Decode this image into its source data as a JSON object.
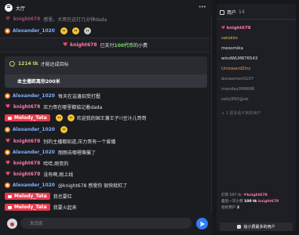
{
  "header": {
    "title": "大厅"
  },
  "messages_top": [
    {
      "badge": "heart",
      "user": "knight678",
      "user_color": "pink",
      "text": "感恩，大哥在这打几分钟dada",
      "emoji": false
    },
    {
      "badge": "orange",
      "user": "Alexander_1020",
      "user_color": "blue",
      "text": "",
      "emoji": true
    }
  ],
  "gift": {
    "user": "knight678",
    "pre": "已支付",
    "amount": "100代币",
    "post": "的小费"
  },
  "goal": {
    "tk": "1214 tk",
    "goal_text": "才能达成目标",
    "bar_text": "本主播距离你200米"
  },
  "messages": [
    {
      "badge": "orange",
      "user": "Alexander_1020",
      "user_color": "blue",
      "text": "每天在這邊招受打壓"
    },
    {
      "badge": "heart",
      "user": "knight678",
      "user_color": "pink",
      "text": "压力哥在哪里都惦记着dada"
    },
    {
      "badge": "pill",
      "user": "Melody_Tata",
      "user_color": "",
      "text": "欢迎我的国王兼王子!!豆汁儿哥哥"
    },
    {
      "badge": "orange",
      "user": "Alexander_1020",
      "user_color": "blue",
      "text": ""
    },
    {
      "badge": "heart",
      "user": "knight678",
      "user_color": "pink",
      "text": "别的主播都知道,压力哥有一个爱播"
    },
    {
      "badge": "orange",
      "user": "Alexander_1020",
      "user_color": "blue",
      "text": "剛剛去哪裡專屬了"
    },
    {
      "badge": "heart",
      "user": "knight678",
      "user_color": "pink",
      "text": "哈哈,刚变的"
    },
    {
      "badge": "heart",
      "user": "knight678",
      "user_color": "pink",
      "text": "没有啊,刚上线"
    },
    {
      "badge": "orange",
      "user": "Alexander_1020",
      "user_color": "blue",
      "text": "@knight678 感覺你 很快就紅了"
    },
    {
      "badge": "pill",
      "user": "Melody_Tata",
      "user_color": "",
      "text": "我也要红"
    },
    {
      "badge": "pill",
      "user": "Melody_Tata",
      "user_color": "",
      "text": "我要火起来"
    }
  ],
  "input": {
    "placeholder": "发消息"
  },
  "side": {
    "title": "用户",
    "count": "14",
    "users": [
      {
        "name": "knight678",
        "color": "pinkb",
        "heart": true
      },
      {
        "name": "satokko",
        "color": "gold"
      },
      {
        "name": "mesomika",
        "color": "white"
      },
      {
        "name": "windWLM876543",
        "color": "white"
      },
      {
        "name": "UntowardZinc",
        "color": "orange"
      },
      {
        "name": "doraemon0107",
        "color": "gray"
      },
      {
        "name": "manday999666",
        "color": "gray"
      },
      {
        "name": "sally950@xb",
        "color": "gray"
      }
    ],
    "more": "+ 3 更多看不到的用户",
    "stats": {
      "l1_pre": "打赏 597 tk:",
      "l1_user": "knight678",
      "l2_pre": "最后一次小费",
      "l2_amt": "100 tk",
      "l2_user": "knight678",
      "l3": "指标用户",
      "l3_n": "2"
    },
    "rank_btn": "给小费最多的用户"
  }
}
